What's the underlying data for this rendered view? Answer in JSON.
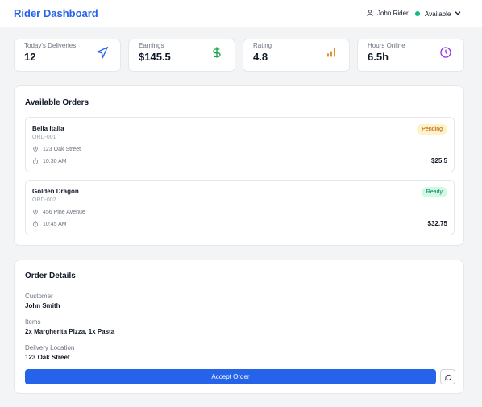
{
  "header": {
    "title": "Rider Dashboard",
    "user_name": "John Rider",
    "status": "Available",
    "status_color": "#10b981"
  },
  "stats": [
    {
      "label": "Today's Deliveries",
      "value": "12",
      "icon": "navigation-icon",
      "color": "#2563eb"
    },
    {
      "label": "Earnings",
      "value": "$145.5",
      "icon": "dollar-icon",
      "color": "#16a34a"
    },
    {
      "label": "Rating",
      "value": "4.8",
      "icon": "bar-chart-icon",
      "color": "#d97706"
    },
    {
      "label": "Hours Online",
      "value": "6.5h",
      "icon": "clock-icon",
      "color": "#9333ea"
    }
  ],
  "available_orders": {
    "title": "Available Orders",
    "orders": [
      {
        "restaurant": "Bella Italia",
        "id": "ORD-001",
        "address": "123 Oak Street",
        "time": "10:30 AM",
        "status": "Pending",
        "price": "$25.5"
      },
      {
        "restaurant": "Golden Dragon",
        "id": "ORD-002",
        "address": "456 Pine Avenue",
        "time": "10:45 AM",
        "status": "Ready",
        "price": "$32.75"
      }
    ]
  },
  "order_details": {
    "title": "Order Details",
    "customer_label": "Customer",
    "customer": "John Smith",
    "items_label": "Items",
    "items": "2x Margherita Pizza, 1x Pasta",
    "location_label": "Delivery Location",
    "location": "123 Oak Street",
    "accept_label": "Accept Order"
  },
  "colors": {
    "accent": "#2563eb",
    "pending_bg": "#fef3c7",
    "ready_bg": "#d1fae5"
  }
}
